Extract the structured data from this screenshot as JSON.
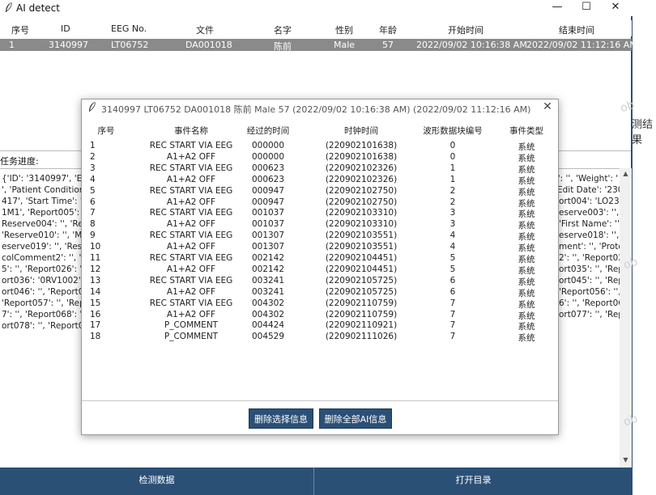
{
  "window": {
    "title": "AI detect",
    "minimize": "—",
    "maximize": "☐",
    "close": "✕"
  },
  "record_table": {
    "headers": [
      "序号",
      "ID",
      "EEG No.",
      "文件",
      "名字",
      "性别",
      "年龄",
      "开始时间",
      "结束时间"
    ],
    "rows": [
      [
        "1",
        "3140997",
        "LT06752",
        "DA001018",
        "陈前",
        "Male",
        "57",
        "2022/09/02  10:16:38 AM",
        "2022/09/02  11:12:16 AM"
      ]
    ]
  },
  "right_edge_text": "测结果",
  "task_progress_label": "任务进度:",
  "log_lines": [
    "{'ID': '3140997', 'EEG",
    "', 'Patient Condition':",
    "417', 'Start Time': '10:",
    "1M1', 'Report005': '1",
    "Reserve004': '', 'Rese",
    "'Reserve010': '', 'M.I.'",
    "eserve019': '', 'Reser",
    "colComment2': '', 'Pr",
    "5': '', 'Report026': '',",
    "ort036': '0RV1002', 'R",
    "ort046': '', 'Report047",
    "'Report057': '', 'Repo",
    "7': '', 'Report068': '',",
    "ort078': '', 'Report079"
  ],
  "log_lines_right": [
    "nt': '', 'Weight': '",
    "Edit Date': '230",
    "ort004': 'LO235",
    "eserve003': '', '",
    "'First Name': '',",
    "eserve018': '', 'R",
    "ment': '', 'Proto",
    "2': '', 'Report02",
    "ort035': '', 'Rep",
    "ort045': '', 'Rep",
    "'Report056': '',",
    "6': '', 'Report06",
    "ort077': '', 'Rep"
  ],
  "bottom_buttons": {
    "detect": "检测数据",
    "open_dir": "打开目录"
  },
  "dialog": {
    "title": "3140997 LT06752 DA001018 陈前 Male 57 (2022/09/02  10:16:38 AM) (2022/09/02  11:12:16 AM)",
    "close": "✕",
    "headers": [
      "序号",
      "事件名称",
      "经过的时间",
      "时钟时间",
      "波形数据块编号",
      "事件类型"
    ],
    "rows": [
      [
        "1",
        "REC START VIA EEG",
        "000000",
        "(220902101638)",
        "0",
        "系统"
      ],
      [
        "2",
        "A1+A2 OFF",
        "000000",
        "(220902101638)",
        "0",
        "系统"
      ],
      [
        "3",
        "REC START VIA EEG",
        "000623",
        "(220902102326)",
        "1",
        "系统"
      ],
      [
        "4",
        "A1+A2 OFF",
        "000623",
        "(220902102326)",
        "1",
        "系统"
      ],
      [
        "5",
        "REC START VIA EEG",
        "000947",
        "(220902102750)",
        "2",
        "系统"
      ],
      [
        "6",
        "A1+A2 OFF",
        "000947",
        "(220902102750)",
        "2",
        "系统"
      ],
      [
        "7",
        "REC START VIA EEG",
        "001037",
        "(220902103310)",
        "3",
        "系统"
      ],
      [
        "8",
        "A1+A2 OFF",
        "001037",
        "(220902103310)",
        "3",
        "系统"
      ],
      [
        "9",
        "REC START VIA EEG",
        "001307",
        "(220902103551)",
        "4",
        "系统"
      ],
      [
        "10",
        "A1+A2 OFF",
        "001307",
        "(220902103551)",
        "4",
        "系统"
      ],
      [
        "11",
        "REC START VIA EEG",
        "002142",
        "(220902104451)",
        "5",
        "系统"
      ],
      [
        "12",
        "A1+A2 OFF",
        "002142",
        "(220902104451)",
        "5",
        "系统"
      ],
      [
        "13",
        "REC START VIA EEG",
        "003241",
        "(220902105725)",
        "6",
        "系统"
      ],
      [
        "14",
        "A1+A2 OFF",
        "003241",
        "(220902105725)",
        "6",
        "系统"
      ],
      [
        "15",
        "REC START VIA EEG",
        "004302",
        "(220902110759)",
        "7",
        "系统"
      ],
      [
        "16",
        "A1+A2 OFF",
        "004302",
        "(220902110759)",
        "7",
        "系统"
      ],
      [
        "17",
        "P_COMMENT",
        "004424",
        "(220902110921)",
        "7",
        "系统"
      ],
      [
        "18",
        "P_COMMENT",
        "004529",
        "(220902111026)",
        "7",
        "系统"
      ]
    ],
    "buttons": {
      "delete_selected": "删除选择信息",
      "delete_all": "删除全部AI信息"
    }
  },
  "watermark_text": "ob",
  "colors": {
    "accent": "#2b5076",
    "selected_row": "#8a8a8a"
  }
}
